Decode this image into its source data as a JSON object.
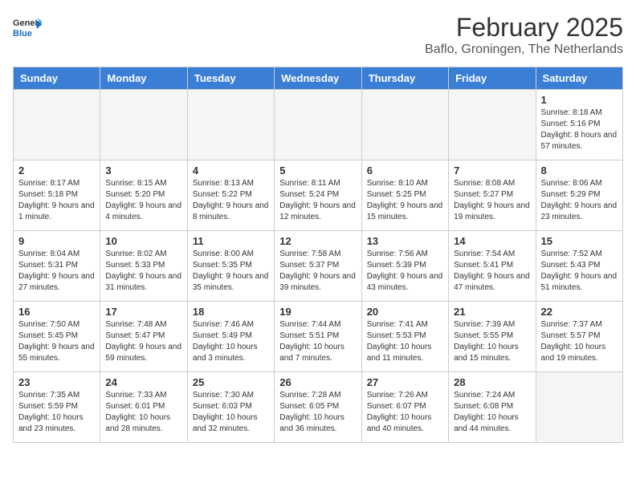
{
  "header": {
    "logo_general": "General",
    "logo_blue": "Blue",
    "month": "February 2025",
    "location": "Baflo, Groningen, The Netherlands"
  },
  "weekdays": [
    "Sunday",
    "Monday",
    "Tuesday",
    "Wednesday",
    "Thursday",
    "Friday",
    "Saturday"
  ],
  "weeks": [
    [
      {
        "day": "",
        "info": ""
      },
      {
        "day": "",
        "info": ""
      },
      {
        "day": "",
        "info": ""
      },
      {
        "day": "",
        "info": ""
      },
      {
        "day": "",
        "info": ""
      },
      {
        "day": "",
        "info": ""
      },
      {
        "day": "1",
        "info": "Sunrise: 8:18 AM\nSunset: 5:16 PM\nDaylight: 8 hours and 57 minutes."
      }
    ],
    [
      {
        "day": "2",
        "info": "Sunrise: 8:17 AM\nSunset: 5:18 PM\nDaylight: 9 hours and 1 minute."
      },
      {
        "day": "3",
        "info": "Sunrise: 8:15 AM\nSunset: 5:20 PM\nDaylight: 9 hours and 4 minutes."
      },
      {
        "day": "4",
        "info": "Sunrise: 8:13 AM\nSunset: 5:22 PM\nDaylight: 9 hours and 8 minutes."
      },
      {
        "day": "5",
        "info": "Sunrise: 8:11 AM\nSunset: 5:24 PM\nDaylight: 9 hours and 12 minutes."
      },
      {
        "day": "6",
        "info": "Sunrise: 8:10 AM\nSunset: 5:25 PM\nDaylight: 9 hours and 15 minutes."
      },
      {
        "day": "7",
        "info": "Sunrise: 8:08 AM\nSunset: 5:27 PM\nDaylight: 9 hours and 19 minutes."
      },
      {
        "day": "8",
        "info": "Sunrise: 8:06 AM\nSunset: 5:29 PM\nDaylight: 9 hours and 23 minutes."
      }
    ],
    [
      {
        "day": "9",
        "info": "Sunrise: 8:04 AM\nSunset: 5:31 PM\nDaylight: 9 hours and 27 minutes."
      },
      {
        "day": "10",
        "info": "Sunrise: 8:02 AM\nSunset: 5:33 PM\nDaylight: 9 hours and 31 minutes."
      },
      {
        "day": "11",
        "info": "Sunrise: 8:00 AM\nSunset: 5:35 PM\nDaylight: 9 hours and 35 minutes."
      },
      {
        "day": "12",
        "info": "Sunrise: 7:58 AM\nSunset: 5:37 PM\nDaylight: 9 hours and 39 minutes."
      },
      {
        "day": "13",
        "info": "Sunrise: 7:56 AM\nSunset: 5:39 PM\nDaylight: 9 hours and 43 minutes."
      },
      {
        "day": "14",
        "info": "Sunrise: 7:54 AM\nSunset: 5:41 PM\nDaylight: 9 hours and 47 minutes."
      },
      {
        "day": "15",
        "info": "Sunrise: 7:52 AM\nSunset: 5:43 PM\nDaylight: 9 hours and 51 minutes."
      }
    ],
    [
      {
        "day": "16",
        "info": "Sunrise: 7:50 AM\nSunset: 5:45 PM\nDaylight: 9 hours and 55 minutes."
      },
      {
        "day": "17",
        "info": "Sunrise: 7:48 AM\nSunset: 5:47 PM\nDaylight: 9 hours and 59 minutes."
      },
      {
        "day": "18",
        "info": "Sunrise: 7:46 AM\nSunset: 5:49 PM\nDaylight: 10 hours and 3 minutes."
      },
      {
        "day": "19",
        "info": "Sunrise: 7:44 AM\nSunset: 5:51 PM\nDaylight: 10 hours and 7 minutes."
      },
      {
        "day": "20",
        "info": "Sunrise: 7:41 AM\nSunset: 5:53 PM\nDaylight: 10 hours and 11 minutes."
      },
      {
        "day": "21",
        "info": "Sunrise: 7:39 AM\nSunset: 5:55 PM\nDaylight: 10 hours and 15 minutes."
      },
      {
        "day": "22",
        "info": "Sunrise: 7:37 AM\nSunset: 5:57 PM\nDaylight: 10 hours and 19 minutes."
      }
    ],
    [
      {
        "day": "23",
        "info": "Sunrise: 7:35 AM\nSunset: 5:59 PM\nDaylight: 10 hours and 23 minutes."
      },
      {
        "day": "24",
        "info": "Sunrise: 7:33 AM\nSunset: 6:01 PM\nDaylight: 10 hours and 28 minutes."
      },
      {
        "day": "25",
        "info": "Sunrise: 7:30 AM\nSunset: 6:03 PM\nDaylight: 10 hours and 32 minutes."
      },
      {
        "day": "26",
        "info": "Sunrise: 7:28 AM\nSunset: 6:05 PM\nDaylight: 10 hours and 36 minutes."
      },
      {
        "day": "27",
        "info": "Sunrise: 7:26 AM\nSunset: 6:07 PM\nDaylight: 10 hours and 40 minutes."
      },
      {
        "day": "28",
        "info": "Sunrise: 7:24 AM\nSunset: 6:08 PM\nDaylight: 10 hours and 44 minutes."
      },
      {
        "day": "",
        "info": ""
      }
    ]
  ]
}
